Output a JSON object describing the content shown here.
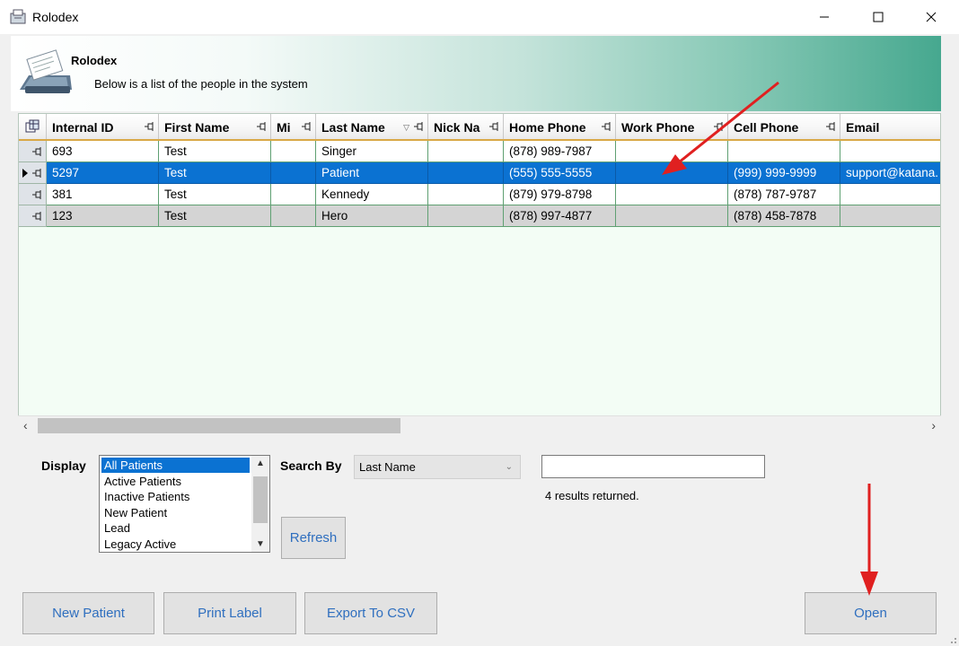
{
  "window": {
    "title": "Rolodex",
    "app_icon": "rolodex-icon"
  },
  "banner": {
    "title": "Rolodex",
    "subtitle": "Below is a list of the people in the system"
  },
  "grid": {
    "columns": [
      "Internal ID",
      "First Name",
      "Mi",
      "Last Name",
      "Nick Na",
      "Home Phone",
      "Work Phone",
      "Cell Phone",
      "Email"
    ],
    "sorted_column": "Last Name",
    "sort_direction": "descending",
    "rows": [
      {
        "internal_id": "693",
        "first_name": "Test",
        "mi": "",
        "last_name": "Singer",
        "nick_name": "",
        "home_phone": "(878) 989-7987",
        "work_phone": "",
        "cell_phone": "",
        "email": ""
      },
      {
        "internal_id": "5297",
        "first_name": "Test",
        "mi": "",
        "last_name": "Patient",
        "nick_name": "",
        "home_phone": "(555) 555-5555",
        "work_phone": "",
        "cell_phone": "(999) 999-9999",
        "email": "support@katana."
      },
      {
        "internal_id": "381",
        "first_name": "Test",
        "mi": "",
        "last_name": "Kennedy",
        "nick_name": "",
        "home_phone": "(879) 979-8798",
        "work_phone": "",
        "cell_phone": "(878) 787-9787",
        "email": ""
      },
      {
        "internal_id": "123",
        "first_name": "Test",
        "mi": "",
        "last_name": "Hero",
        "nick_name": "",
        "home_phone": "(878) 997-4877",
        "work_phone": "",
        "cell_phone": "(878) 458-7878",
        "email": ""
      }
    ],
    "selected_row_index": 1
  },
  "filters": {
    "display_label": "Display",
    "display_options": [
      "All Patients",
      "Active Patients",
      "Inactive Patients",
      "New Patient",
      "Lead",
      "Legacy Active"
    ],
    "display_selected": "All Patients",
    "search_by_label": "Search By",
    "search_by_value": "Last Name",
    "search_text": "",
    "results_text": "4 results returned.",
    "refresh_label": "Refresh"
  },
  "actions": {
    "new_patient": "New Patient",
    "print_label": "Print Label",
    "export_csv": "Export To CSV",
    "open": "Open"
  },
  "colors": {
    "selection": "#0b72d2",
    "banner_end": "#46a88f",
    "annotation_arrow": "#e02020",
    "button_text": "#2f6fbf"
  }
}
